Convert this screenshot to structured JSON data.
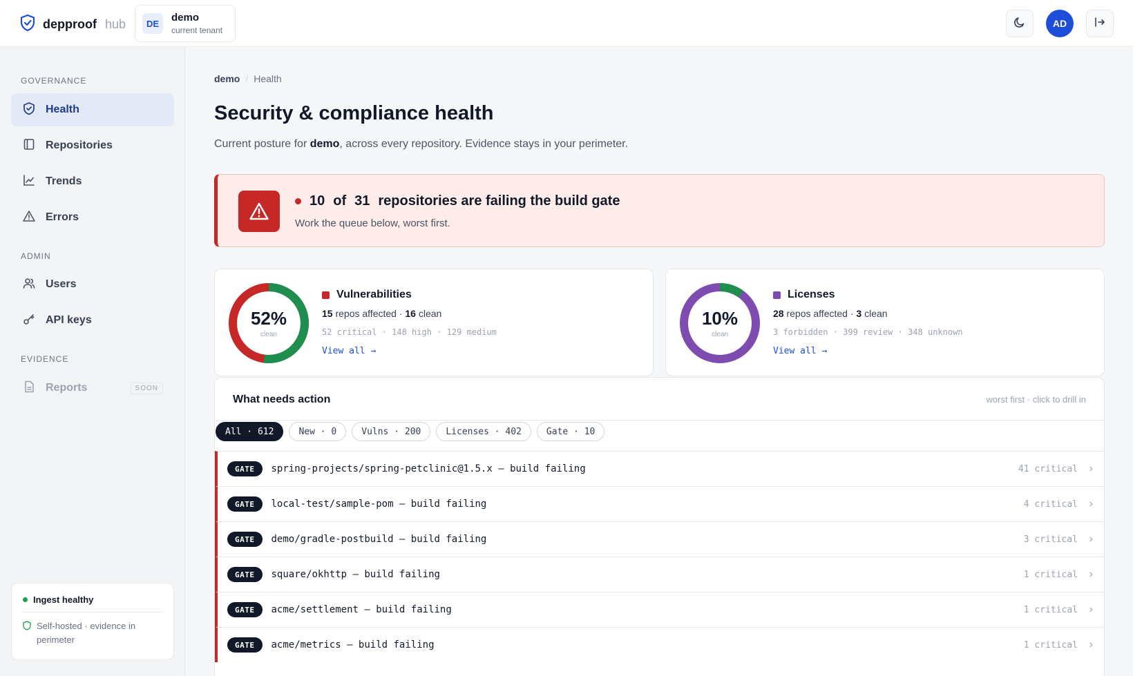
{
  "header": {
    "brand": "depproof",
    "brand_suffix": "hub",
    "tenant_badge": "DE",
    "tenant_name": "demo",
    "tenant_sub": "current tenant",
    "avatar": "AD",
    "icons": {
      "logo": "shield-check-icon",
      "theme": "moon-icon",
      "logout": "logout-icon"
    }
  },
  "sidebar": {
    "sections": [
      {
        "label": "GOVERNANCE"
      },
      {
        "label": "ADMIN"
      },
      {
        "label": "EVIDENCE"
      }
    ],
    "items": [
      {
        "label": "Health",
        "icon": "shield-icon",
        "active": true
      },
      {
        "label": "Repositories",
        "icon": "repo-icon"
      },
      {
        "label": "Trends",
        "icon": "trend-icon"
      },
      {
        "label": "Errors",
        "icon": "warning-icon"
      },
      {
        "label": "Users",
        "icon": "users-icon"
      },
      {
        "label": "API keys",
        "icon": "key-icon"
      },
      {
        "label": "Reports",
        "icon": "document-icon",
        "badge": "SOON"
      }
    ],
    "ingest": {
      "status": "Ingest healthy",
      "note": "Self-hosted · evidence in perimeter"
    }
  },
  "breadcrumb": {
    "current": "demo",
    "separator": "/",
    "page": "Health"
  },
  "page": {
    "title": "Security & compliance health",
    "sub_prefix": "Current posture for ",
    "sub_tenant": "demo",
    "sub_suffix": ", across every repository. Evidence stays in your perimeter."
  },
  "alert": {
    "failing": "10",
    "of_word": "of",
    "total": "31",
    "title_rest": "repositories are failing the build gate",
    "sub": "Work the queue below, worst first."
  },
  "cards": [
    {
      "title": "Vulnerabilities",
      "accent": "#c62828",
      "clean_pct": 52,
      "pct_label": "52%",
      "center_label": "clean",
      "affected": "15",
      "affected_text": " repos affected · ",
      "clean": "16",
      "clean_text": " clean",
      "breakdown": "52 critical · 148 high · 129 medium",
      "link": "View all →"
    },
    {
      "title": "Licenses",
      "accent": "#7e4bb0",
      "clean_pct": 10,
      "pct_label": "10%",
      "center_label": "clean",
      "affected": "28",
      "affected_text": " repos affected · ",
      "clean": "3",
      "clean_text": " clean",
      "breakdown": "3 forbidden · 399 review · 348 unknown",
      "link": "View all →"
    }
  ],
  "colors": {
    "clean": "#1e8e4f",
    "danger": "#c62828",
    "license": "#7e4bb0",
    "brand": "#1d4ed8"
  },
  "action": {
    "title": "What needs action",
    "hint": "worst first · click to drill in",
    "chips": [
      {
        "label": "All · 612",
        "active": true
      },
      {
        "label": "New · 0"
      },
      {
        "label": "Vulns · 200"
      },
      {
        "label": "Licenses · 402"
      },
      {
        "label": "Gate · 10"
      }
    ],
    "rows": [
      {
        "tag": "GATE",
        "text": "spring-projects/spring-petclinic@1.5.x — build failing",
        "meta": "41 critical"
      },
      {
        "tag": "GATE",
        "text": "local-test/sample-pom — build failing",
        "meta": "4 critical"
      },
      {
        "tag": "GATE",
        "text": "demo/gradle-postbuild — build failing",
        "meta": "3 critical"
      },
      {
        "tag": "GATE",
        "text": "square/okhttp — build failing",
        "meta": "1 critical"
      },
      {
        "tag": "GATE",
        "text": "acme/settlement — build failing",
        "meta": "1 critical"
      },
      {
        "tag": "GATE",
        "text": "acme/metrics — build failing",
        "meta": "1 critical"
      }
    ]
  }
}
